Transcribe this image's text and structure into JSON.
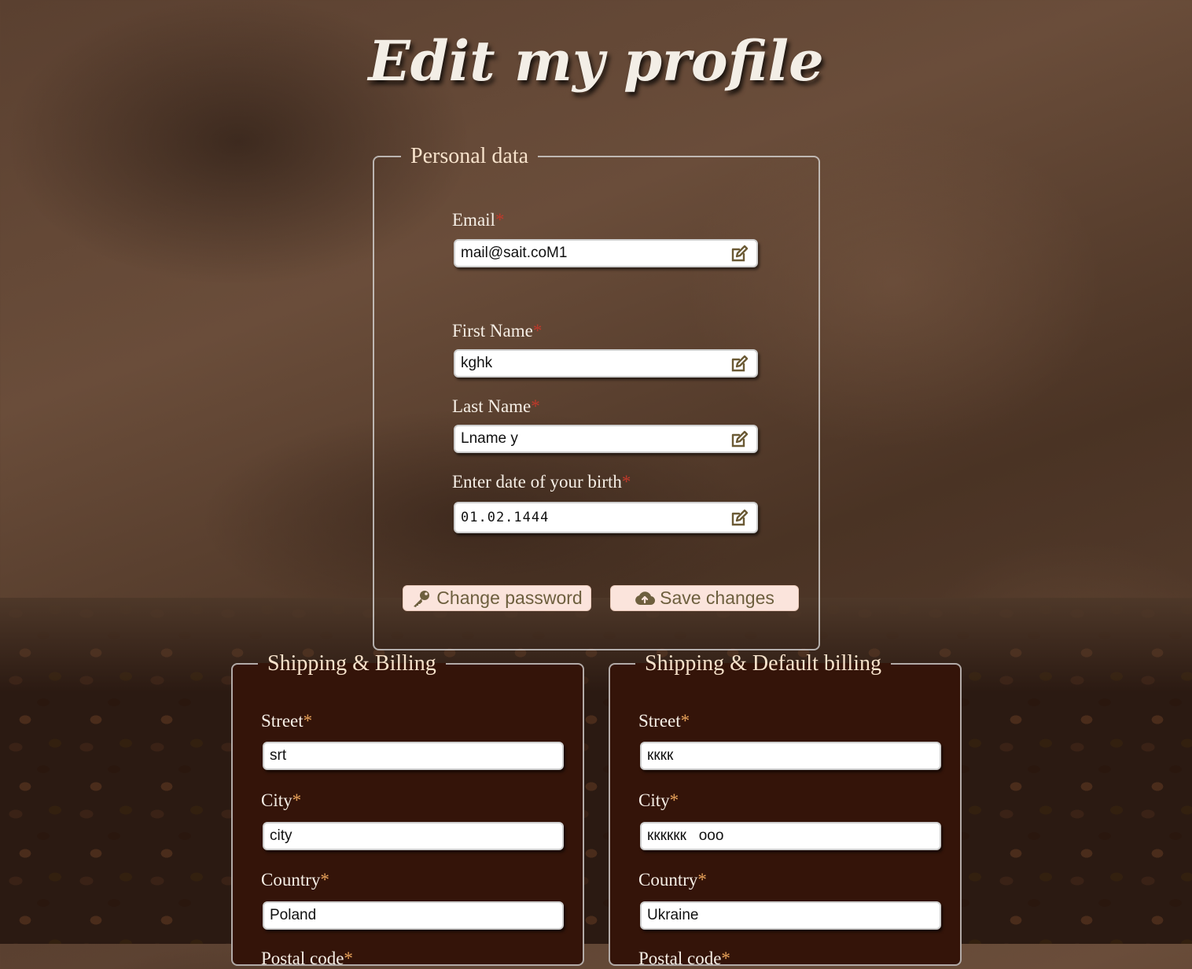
{
  "page": {
    "title": "Edit my profile"
  },
  "personal": {
    "legend": "Personal data",
    "email": {
      "label": "Email",
      "value": "mail@sait.coM1"
    },
    "first_name": {
      "label": "First Name",
      "value": "kghk"
    },
    "last_name": {
      "label": "Last Name",
      "value": "Lname y"
    },
    "birth": {
      "label": "Enter date of your birth",
      "value": "01.02.1444"
    },
    "required_mark": "*",
    "change_password_label": "Change password",
    "save_changes_label": "Save changes"
  },
  "shipping_billing": {
    "legend": "Shipping & Billing",
    "street": {
      "label": "Street",
      "value": "srt"
    },
    "city": {
      "label": "City",
      "value": "city"
    },
    "country": {
      "label": "Country",
      "value": "Poland"
    },
    "postal": {
      "label": "Postal code"
    }
  },
  "shipping_default": {
    "legend": "Shipping & Default billing",
    "street": {
      "label": "Street",
      "value": "кккк"
    },
    "city": {
      "label": "City",
      "value": "кккккк   ооо"
    },
    "country": {
      "label": "Country",
      "value": "Ukraine"
    },
    "postal": {
      "label": "Postal code"
    }
  },
  "icons": [
    "edit-icon",
    "key-icon",
    "cloud-upload-icon"
  ],
  "colors": {
    "field_background": "#ffffff",
    "button_background": "#fbe4dc",
    "panel_background": "#341409",
    "required_red": "#c0392b",
    "required_orange": "#e8a25a"
  }
}
